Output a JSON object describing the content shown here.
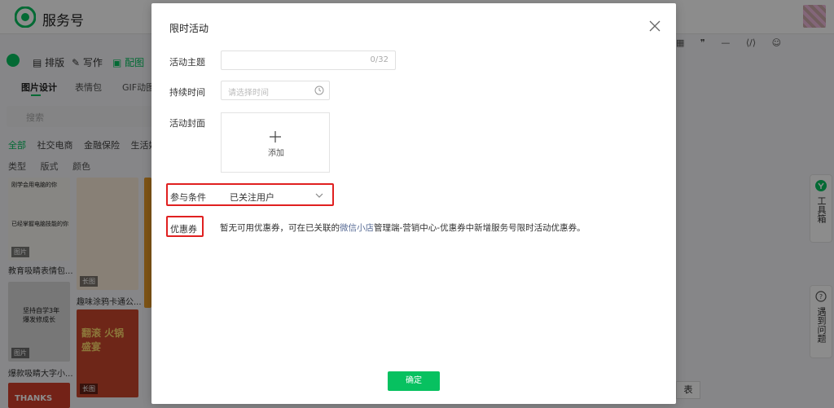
{
  "app": {
    "brand": "服务号",
    "toolbar": [
      "排版",
      "写作",
      "配图"
    ],
    "tabs": [
      "图片设计",
      "表情包",
      "GIF动图"
    ],
    "search_placeholder": "搜索",
    "categories": [
      "全部",
      "社交电商",
      "金融保险",
      "生活娱乐"
    ],
    "filters": [
      "类型",
      "版式",
      "颜色"
    ],
    "thumb_captions": [
      "教育吸睛表情包...",
      "趣味涂鸦卡通公...",
      "爆款吸睛大字小..."
    ],
    "thumb_texts": {
      "t1_title": "刚学会用电脑的你",
      "t1_sub": "已经掌握电脑技能的你",
      "badge_pic": "图片",
      "badge_long": "长图",
      "t4_text": "坚持自学3年 爆发修成长",
      "t5_text": "翻滚 火锅盛宴",
      "t6_text": "THANKS"
    },
    "right_tools": [
      "▦",
      "❞",
      "—",
      "⟨/⟩",
      "☺"
    ],
    "side_tools": {
      "toolbox": "工具箱",
      "problem": "遇到问题"
    },
    "bottom_right_fragment": "表"
  },
  "modal": {
    "title": "限时活动",
    "fields": {
      "theme_label": "活动主题",
      "theme_counter": "0/32",
      "duration_label": "持续时间",
      "duration_placeholder": "请选择时间",
      "cover_label": "活动封面",
      "cover_add": "添加",
      "condition_label": "参与条件",
      "condition_value": "已关注用户",
      "coupon_label": "优惠券",
      "coupon_text_before": "暂无可用优惠券，可在已关联的",
      "coupon_link": "微信小店",
      "coupon_text_after": "管理端-营销中心-优惠券中新增服务号限时活动优惠券。"
    },
    "confirm_label": "确定"
  },
  "colors": {
    "accent": "#07c160",
    "highlight_border": "#e02020",
    "link": "#576b95"
  }
}
